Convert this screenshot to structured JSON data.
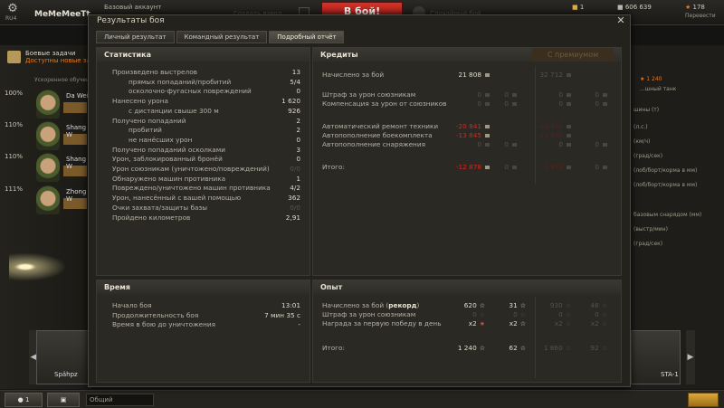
{
  "topbar": {
    "region": "RU4",
    "nickname": "MeMeMeeTt",
    "account_type": "Базовый аккаунт",
    "create_platoon": "Создать взвод",
    "battle_button": "В бой!",
    "battle_mode": "Случайный бой",
    "gold": "1",
    "silver": "606 639",
    "free_xp": "1 240",
    "xp_total": "178",
    "convert": "Перевести"
  },
  "left": {
    "quests_title": "Боевые задачи",
    "quests_sub": "Доступны новые задачи",
    "accelerated": "Ускоренное обучение",
    "crew": [
      {
        "pct": "100%",
        "name": "Da Wei"
      },
      {
        "pct": "110%",
        "name": "Shang W"
      },
      {
        "pct": "110%",
        "name": "Shang W"
      },
      {
        "pct": "111%",
        "name": "Zhong W"
      }
    ],
    "tank_left": "Spähpz",
    "tank_right": "STA-1"
  },
  "right_panel": {
    "lines": [
      "...шный танк",
      "шины (т)",
      "(л.с.)",
      "(км/ч)",
      "(град/сек)",
      "(лоб/борт/корма в мм)",
      "(лоб/борт/корма в мм)",
      "базовым снарядом (мм)",
      "(выстр/мин)",
      "(град/сек)"
    ],
    "xp_value": "1 240"
  },
  "bottombar": {
    "players": "1",
    "chat_placeholder": "Общий"
  },
  "dialog": {
    "title": "Результаты боя",
    "tabs": [
      "Личный результат",
      "Командный результат",
      "Подробный отчёт"
    ],
    "stats": {
      "header": "Статистика",
      "rows": [
        {
          "label": "Произведено выстрелов",
          "value": "13"
        },
        {
          "label": "прямых попаданий/пробитий",
          "value": "5/4",
          "indent": true
        },
        {
          "label": "осколочно-фугасных повреждений",
          "value": "0",
          "indent": true
        },
        {
          "label": "Нанесено урона",
          "value": "1 620"
        },
        {
          "label": "с дистанции свыше 300 м",
          "value": "926",
          "indent": true
        },
        {
          "label": "Получено попаданий",
          "value": "2"
        },
        {
          "label": "пробитий",
          "value": "2",
          "indent": true
        },
        {
          "label": "не нанёсших урон",
          "value": "0",
          "indent": true
        },
        {
          "label": "Получено попаданий осколками",
          "value": "3"
        },
        {
          "label": "Урон, заблокированный бронёй",
          "value": "0"
        },
        {
          "label": "Урон союзникам (уничтожено/повреждений)",
          "value": "0/0"
        },
        {
          "label": "Обнаружено машин противника",
          "value": "1"
        },
        {
          "label": "Повреждено/уничтожено машин противника",
          "value": "4/2"
        },
        {
          "label": "Урон, нанесённый с вашей помощью",
          "value": "362"
        },
        {
          "label": "Очки захвата/защиты базы",
          "value": "0/0"
        },
        {
          "label": "Пройдено километров",
          "value": "2,91"
        }
      ]
    },
    "credits": {
      "header": "Кредиты",
      "premium_header": "С премиумом",
      "earned_label": "Начислено за бой",
      "earned": "21 808",
      "earned_premium": "32 712",
      "fine_label": "Штраф за урон союзникам",
      "fine": "0",
      "fine_b": "0",
      "fine_premium": "0",
      "fine_premium_b": "0",
      "comp_label": "Компенсация за урон от союзников",
      "comp": "0",
      "comp_b": "0",
      "comp_premium": "0",
      "comp_premium_b": "0",
      "repair_label": "Автоматический ремонт техники",
      "repair": "-20 841",
      "repair_premium": "-20 841",
      "ammo_label": "Автопополнение боекомплекта",
      "ammo": "-13 845",
      "ammo_premium": "-13 845",
      "equip_label": "Автопополнение снаряжения",
      "equip": "0",
      "equip_b": "0",
      "equip_premium": "0",
      "equip_premium_b": "0",
      "total_label": "Итого:",
      "total": "-12 878",
      "total_b": "0",
      "total_premium": "-1 974",
      "total_premium_b": "0"
    },
    "time": {
      "header": "Время",
      "rows": [
        {
          "label": "Начало боя",
          "value": "13:01"
        },
        {
          "label": "Продолжительность боя",
          "value": "7 мин 35 с"
        },
        {
          "label": "Время в бою до уничтожения",
          "value": "-"
        }
      ]
    },
    "exp": {
      "header": "Опыт",
      "earned_label": "Начислено за бой",
      "record": "рекорд",
      "earned": "620",
      "earned_free": "31",
      "earned_premium": "930",
      "earned_premium_free": "46",
      "fine_label": "Штраф за урон союзникам",
      "fine": "0",
      "fine_free": "0",
      "fine_premium": "0",
      "fine_premium_free": "0",
      "first_win_label": "Награда за первую победу в день",
      "first_win": "x2",
      "first_win_free": "x2",
      "first_win_premium": "x2",
      "first_win_premium_free": "x2",
      "total_label": "Итого:",
      "total": "1 240",
      "total_free": "62",
      "total_premium": "1 860",
      "total_premium_free": "92"
    }
  }
}
